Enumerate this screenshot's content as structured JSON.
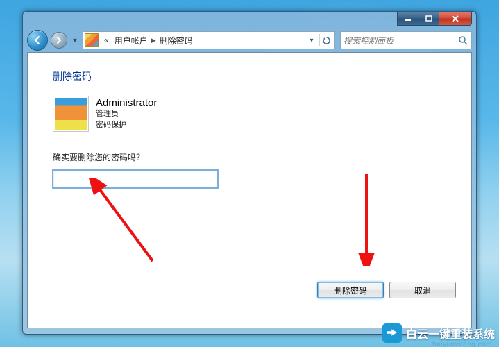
{
  "titlebar": {
    "minimize_tooltip": "Minimize",
    "maximize_tooltip": "Maximize",
    "close_tooltip": "Close"
  },
  "nav": {
    "back_tooltip": "Back",
    "forward_tooltip": "Forward"
  },
  "address": {
    "crumb_double_left": "«",
    "crumb1": "用户帐户",
    "crumb2": "删除密码"
  },
  "search": {
    "placeholder": "搜索控制面板"
  },
  "page": {
    "title": "删除密码",
    "user_name": "Administrator",
    "user_role": "管理员",
    "user_protection": "密码保护",
    "prompt": "确实要删除您的密码吗？"
  },
  "buttons": {
    "primary": "删除密码",
    "cancel": "取消"
  },
  "watermark": {
    "text": "白云一键重装系统",
    "url": "baiyunxitong.com"
  }
}
